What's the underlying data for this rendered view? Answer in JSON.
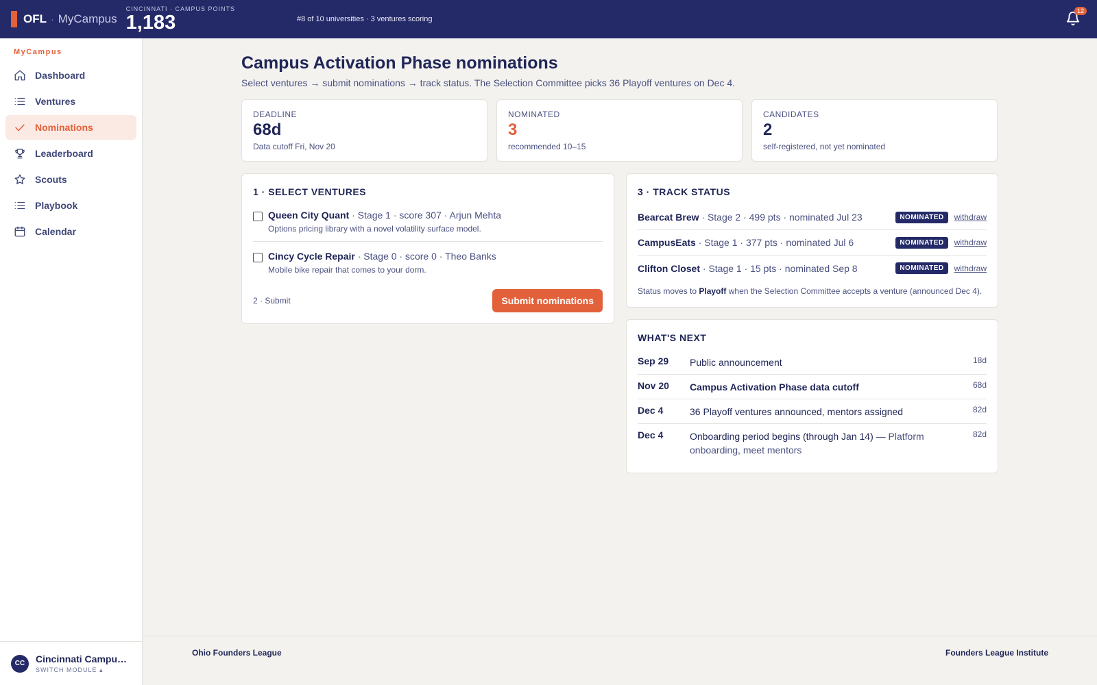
{
  "topbar": {
    "brand": "OFL",
    "separator": "·",
    "app_name": "MyCampus",
    "points_label": "CINCINNATI · CAMPUS POINTS",
    "points_value": "1,183",
    "rank_text": "#8 of 10 universities · 3 ventures scoring",
    "notification_count": "12"
  },
  "sidebar": {
    "section_label": "MyCampus",
    "items": [
      {
        "label": "Dashboard",
        "icon": "home-icon"
      },
      {
        "label": "Ventures",
        "icon": "list-icon"
      },
      {
        "label": "Nominations",
        "icon": "check-icon",
        "active": true
      },
      {
        "label": "Leaderboard",
        "icon": "trophy-icon"
      },
      {
        "label": "Scouts",
        "icon": "star-icon"
      },
      {
        "label": "Playbook",
        "icon": "list-icon"
      },
      {
        "label": "Calendar",
        "icon": "calendar-icon"
      }
    ],
    "footer": {
      "avatar_initials": "CC",
      "campus_name": "Cincinnati Campus …",
      "switch_label": "SWITCH MODULE ▴"
    }
  },
  "main": {
    "title": "Campus Activation Phase nominations",
    "subtitle": "Select ventures → submit nominations → track status. The Selection Committee picks 36 Playoff ventures on Dec 4.",
    "stats": [
      {
        "label": "DEADLINE",
        "value": "68d",
        "note": "Data cutoff Fri, Nov 20"
      },
      {
        "label": "NOMINATED",
        "value": "3",
        "note": "recommended 10–15"
      },
      {
        "label": "CANDIDATES",
        "value": "2",
        "note": "self-registered, not yet nominated"
      }
    ],
    "select": {
      "title": "1 · SELECT VENTURES",
      "ventures": [
        {
          "name": "Queen City Quant",
          "meta": " · Stage 1 · score 307 · Arjun Mehta",
          "desc": "Options pricing library with a novel volatility surface model."
        },
        {
          "name": "Cincy Cycle Repair",
          "meta": " · Stage 0 · score 0 · Theo Banks",
          "desc": "Mobile bike repair that comes to your dorm."
        }
      ],
      "submit_step": "2 · Submit",
      "submit_button": "Submit nominations"
    },
    "track": {
      "title": "3 · TRACK STATUS",
      "rows": [
        {
          "name": "Bearcat Brew",
          "meta": " · Stage 2 · 499 pts · nominated Jul 23",
          "badge": "NOMINATED",
          "action": "withdraw"
        },
        {
          "name": "CampusEats",
          "meta": " · Stage 1 · 377 pts · nominated Jul 6",
          "badge": "NOMINATED",
          "action": "withdraw"
        },
        {
          "name": "Clifton Closet",
          "meta": " · Stage 1 · 15 pts · nominated Sep 8",
          "badge": "NOMINATED",
          "action": "withdraw"
        }
      ],
      "note_before": "Status moves to ",
      "note_bold": "Playoff",
      "note_after": " when the Selection Committee accepts a venture (announced Dec 4)."
    },
    "next": {
      "title": "WHAT'S NEXT",
      "rows": [
        {
          "date": "Sep 29",
          "text": "Public announcement",
          "extra": "",
          "days": "18d"
        },
        {
          "date": "Nov 20",
          "text": "Campus Activation Phase data cutoff",
          "extra": "",
          "days": "68d",
          "bold": true
        },
        {
          "date": "Dec 4",
          "text": "36 Playoff ventures announced, mentors assigned",
          "extra": "",
          "days": "82d"
        },
        {
          "date": "Dec 4",
          "text": "Onboarding period begins (through Jan 14)",
          "extra": " — Platform onboarding, meet mentors",
          "days": "82d"
        }
      ]
    }
  },
  "footer": {
    "left": "Ohio Founders League",
    "right": "Founders League Institute"
  },
  "colors": {
    "navy": "#242a68",
    "accent": "#e2613a",
    "background": "#f3f2ef"
  }
}
